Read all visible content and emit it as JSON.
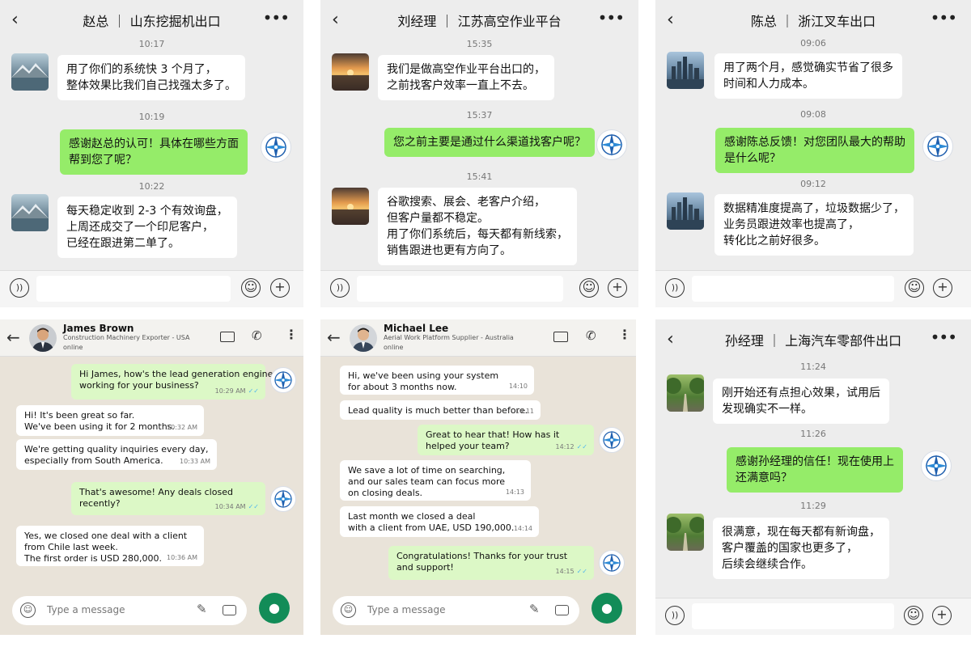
{
  "icons": {
    "back": "back-arrow-icon",
    "more": "more-dots-icon",
    "voice": "voice-icon",
    "emoji": "emoji-icon",
    "plus": "plus-icon",
    "logo": "compass-logo-icon",
    "video": "video-call-icon",
    "call": "phone-icon",
    "attach": "paperclip-icon",
    "camera": "camera-icon",
    "mic": "microphone-icon"
  },
  "colors": {
    "wechat_bg": "#ededed",
    "wechat_out": "#95ec69",
    "whatsapp_bg": "#e9e3d9",
    "whatsapp_out": "#dcf8c6",
    "whatsapp_mic": "#128c58",
    "read_tick": "#4fb6ec"
  },
  "chats": [
    {
      "title": "赵总 ｜ 山东挖掘机出口",
      "messages": [
        {
          "time": "10:17",
          "text": [
            "用了你们的系统快 3 个月了，",
            "整体效果比我们自己找强太多了。"
          ]
        },
        {
          "time": "10:19",
          "text": [
            "感谢赵总的认可！具体在哪些方面",
            "帮到您了呢？"
          ]
        },
        {
          "time": "10:22",
          "text": [
            "每天稳定收到 2-3 个有效询盘，",
            "上周还成交了一个印尼客户，",
            "已经在跟进第二单了。"
          ]
        }
      ]
    },
    {
      "title": "刘经理 ｜ 江苏高空作业平台",
      "messages": [
        {
          "time": "15:35",
          "text": [
            "我们是做高空作业平台出口的，",
            "之前找客户效率一直上不去。"
          ]
        },
        {
          "time": "15:37",
          "text": [
            "您之前主要是通过什么渠道找客户呢？"
          ]
        },
        {
          "time": "15:41",
          "text": [
            "谷歌搜索、展会、老客户介绍，",
            "但客户量都不稳定。",
            "用了你们系统后，每天都有新线索，",
            "销售跟进也更有方向了。"
          ]
        }
      ]
    },
    {
      "title": "陈总 ｜ 浙江叉车出口",
      "messages": [
        {
          "time": "09:06",
          "text": [
            "用了两个月，感觉确实节省了很多",
            "时间和人力成本。"
          ]
        },
        {
          "time": "09:08",
          "text": [
            "感谢陈总反馈！对您团队最大的帮助",
            "是什么呢？"
          ]
        },
        {
          "time": "09:12",
          "text": [
            "数据精准度提高了，垃圾数据少了，",
            "业务员跟进效率也提高了，",
            "转化比之前好很多。"
          ]
        }
      ]
    },
    {
      "title": "孙经理 ｜ 上海汽车零部件出口",
      "messages": [
        {
          "time": "11:24",
          "text": [
            "刚开始还有点担心效果，试用后",
            "发现确实不一样。"
          ]
        },
        {
          "time": "11:26",
          "text": [
            "感谢孙经理的信任！现在使用上",
            "还满意吗？"
          ]
        },
        {
          "time": "11:29",
          "text": [
            "很满意，现在每天都有新询盘，",
            "客户覆盖的国家也更多了，",
            "后续会继续合作。"
          ]
        }
      ]
    }
  ],
  "whatsapp": [
    {
      "name": "James Brown",
      "subtitle": "Construction Machinery Exporter - USA",
      "status": "online",
      "placeholder": "Type a message",
      "messages": [
        {
          "lines": [
            "Hi James, how's the lead generation engine",
            "working for your business?"
          ],
          "time": "10:29 AM",
          "ticks": "✓✓"
        },
        {
          "lines": [
            "Hi! It's been great so far.",
            "We've been using it for 2 months."
          ],
          "time": "10:32 AM"
        },
        {
          "lines": [
            "We're getting quality inquiries every day,",
            "especially from South America."
          ],
          "time": "10:33 AM"
        },
        {
          "lines": [
            "That's awesome! Any deals closed",
            "recently?"
          ],
          "time": "10:34 AM",
          "ticks": "✓✓"
        },
        {
          "lines": [
            "Yes, we closed one deal with a client",
            "from Chile last week.",
            "The first order is USD 280,000."
          ],
          "time": "10:36 AM"
        }
      ]
    },
    {
      "name": "Michael Lee",
      "subtitle": "Aerial Work Platform Supplier - Australia",
      "status": "online",
      "placeholder": "Type a message",
      "messages": [
        {
          "lines": [
            "Hi, we've been using your system",
            "for about 3 months now."
          ],
          "time": "14:10"
        },
        {
          "lines": [
            "Lead quality is much better than before."
          ],
          "time": "14:11"
        },
        {
          "lines": [
            "Great to hear that! How has it",
            "helped your team?"
          ],
          "time": "14:12",
          "ticks": "✓✓"
        },
        {
          "lines": [
            "We save a lot of time on searching,",
            "and our sales team can focus more",
            "on closing deals."
          ],
          "time": "14:13"
        },
        {
          "lines": [
            "Last month we closed a deal",
            "with a client from UAE, USD 190,000."
          ],
          "time": "14:14"
        },
        {
          "lines": [
            "Congratulations! Thanks for your trust",
            "and support!"
          ],
          "time": "14:15",
          "ticks": "✓✓"
        }
      ]
    }
  ]
}
